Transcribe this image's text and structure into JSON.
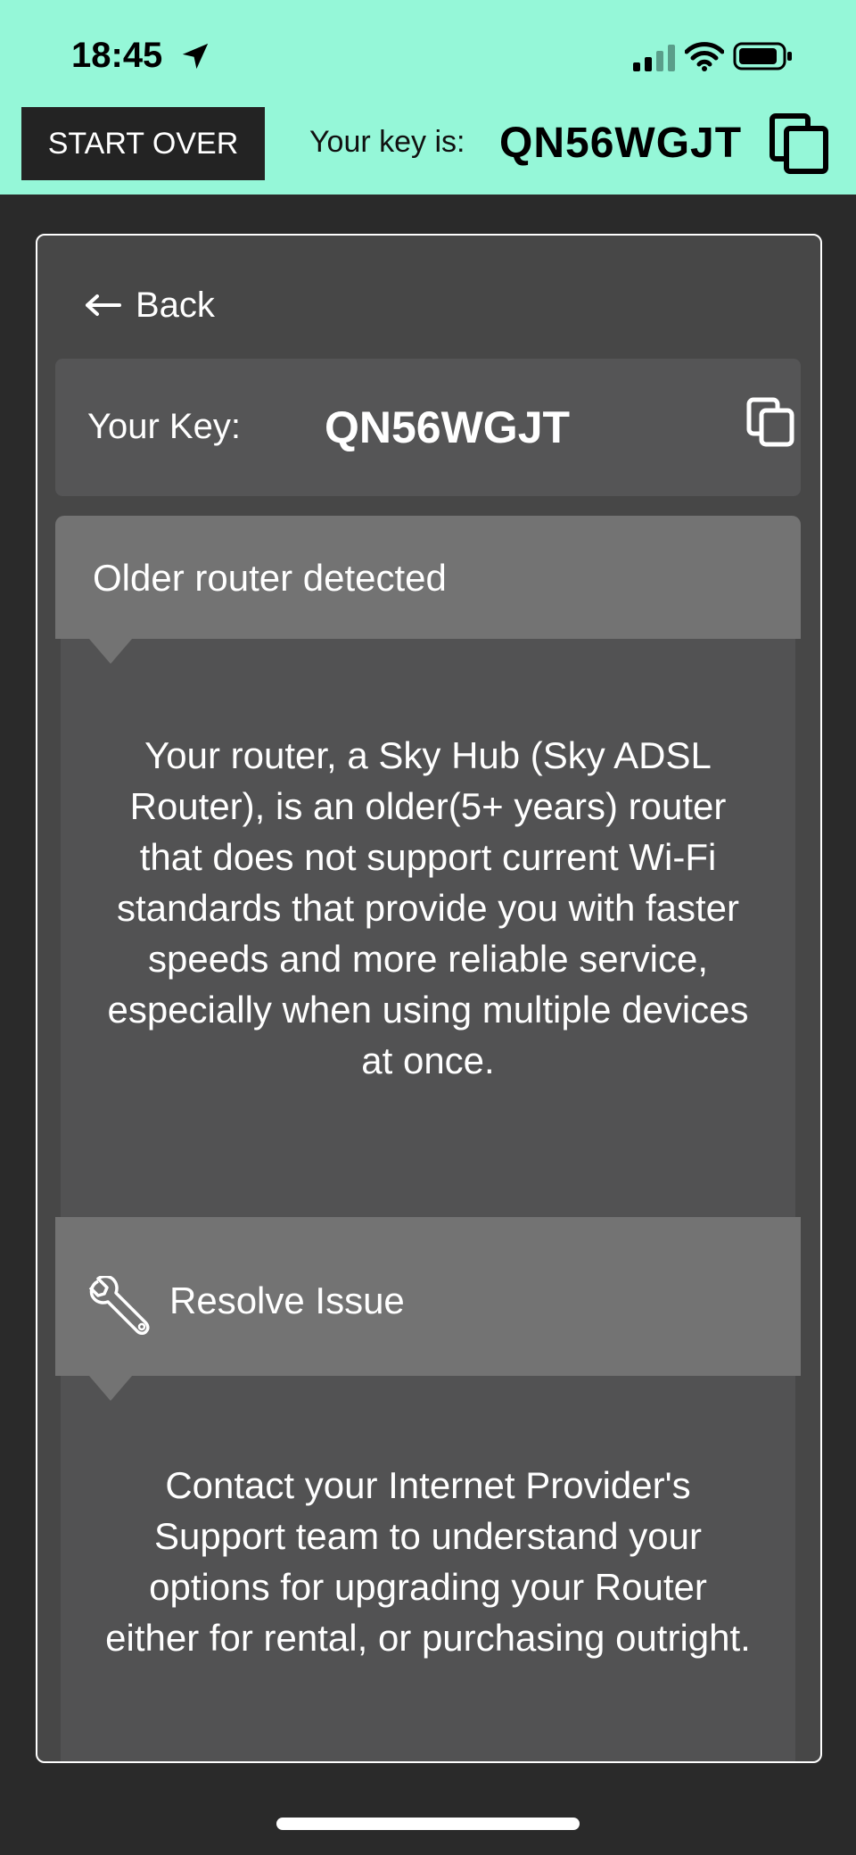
{
  "status_bar": {
    "time": "18:45",
    "icons": [
      "location-arrow-icon",
      "cellular-signal-icon",
      "wifi-icon",
      "battery-icon"
    ]
  },
  "header": {
    "start_over_label": "START OVER",
    "key_label": "Your key is:",
    "key_value": "QN56WGJT",
    "copy_icon": "copy-icon"
  },
  "card": {
    "back_label": "Back",
    "key_label": "Your Key:",
    "key_value": "QN56WGJT",
    "sections": [
      {
        "title": "Older router detected",
        "body": "Your router, a Sky Hub (Sky ADSL Router), is an older(5+ years) router that does not support current Wi-Fi standards that provide you with faster speeds and more reliable service, especially when using multiple devices at once."
      },
      {
        "title": "Resolve Issue",
        "icon": "wrench-icon",
        "body": "Contact your Internet Provider's Support team to understand your options for upgrading your Router either for rental, or purchasing outright."
      }
    ]
  },
  "colors": {
    "header_background": "#95f7d8",
    "page_background": "#2a2a2a",
    "card_background": "#474747",
    "section_header": "#737373",
    "section_body": "#525253"
  }
}
